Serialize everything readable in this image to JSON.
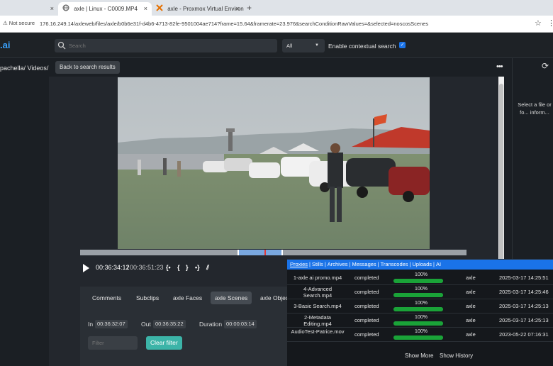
{
  "browser": {
    "tabs": [
      {
        "label": "",
        "close": "×"
      },
      {
        "label": "axle | Linux - C0009.MP4",
        "close": "×"
      },
      {
        "label": "axle - Proxmox Virtual Environ...",
        "close": "×"
      }
    ],
    "new_tab": "+",
    "security": "⚠ Not secure",
    "url": "176.16.249.14/axleweb/files/axle/b0b6e31f-d4b6-4713-82fe-9501004ae714?frame=15.64&framerate=23.976&searchConditionRawValues=&selected=noscosScenes"
  },
  "header": {
    "logo": ".ai",
    "search_placeholder": "Search",
    "scope": "All",
    "contextual_label": "Enable contextual search",
    "contextual_checked": true
  },
  "subbar": {
    "breadcrumb": "pachella/ Videos/",
    "back_label": "Back to search results",
    "more": "•••",
    "refresh": "⟳"
  },
  "right_panel": {
    "info": "Select a file or fo... inform..."
  },
  "player": {
    "current_time": "00:36:34:12",
    "separator": "/",
    "duration": "00:36:51:23",
    "markers": [
      "{•",
      "{",
      "}",
      "•}",
      "⫽"
    ],
    "selection_start": 0.41,
    "selection_end": 0.53,
    "playhead": 0.48
  },
  "panel": {
    "tabs": [
      "Comments",
      "Subclips",
      "axle Faces",
      "axle Scenes",
      "axle Objec"
    ],
    "active_tab": "axle Scenes",
    "in_label": "In",
    "in_value": "00:36:32:07",
    "out_label": "Out",
    "out_value": "00:36:35:22",
    "duration_label": "Duration",
    "duration_value": "00:00:03:14",
    "filter_placeholder": "Filter",
    "clear_label": "Clear filter"
  },
  "jobs": {
    "tabs": [
      "Proxies",
      "Stills",
      "Archives",
      "Messages",
      "Transcodes",
      "Uploads",
      "AI"
    ],
    "active_tab": "Proxies",
    "rows": [
      {
        "name": "1-axle ai promo.mp4",
        "status": "completed",
        "progress": "100%",
        "user": "axle",
        "time": "2025-03-17 14:25:51"
      },
      {
        "name": "4-Advanced Search.mp4",
        "status": "completed",
        "progress": "100%",
        "user": "axle",
        "time": "2025-03-17 14:25:46"
      },
      {
        "name": "3-Basic Search.mp4",
        "status": "completed",
        "progress": "100%",
        "user": "axle",
        "time": "2025-03-17 14:25:13"
      },
      {
        "name": "2-Metadata Editing.mp4",
        "status": "completed",
        "progress": "100%",
        "user": "axle",
        "time": "2025-03-17 14:25:13"
      },
      {
        "name": "AudioTest-Patrice.mov",
        "status": "completed",
        "progress": "100%",
        "user": "axle",
        "time": "2023-05-22 07:16:31"
      }
    ],
    "show_more": "Show More",
    "show_history": "Show History"
  }
}
